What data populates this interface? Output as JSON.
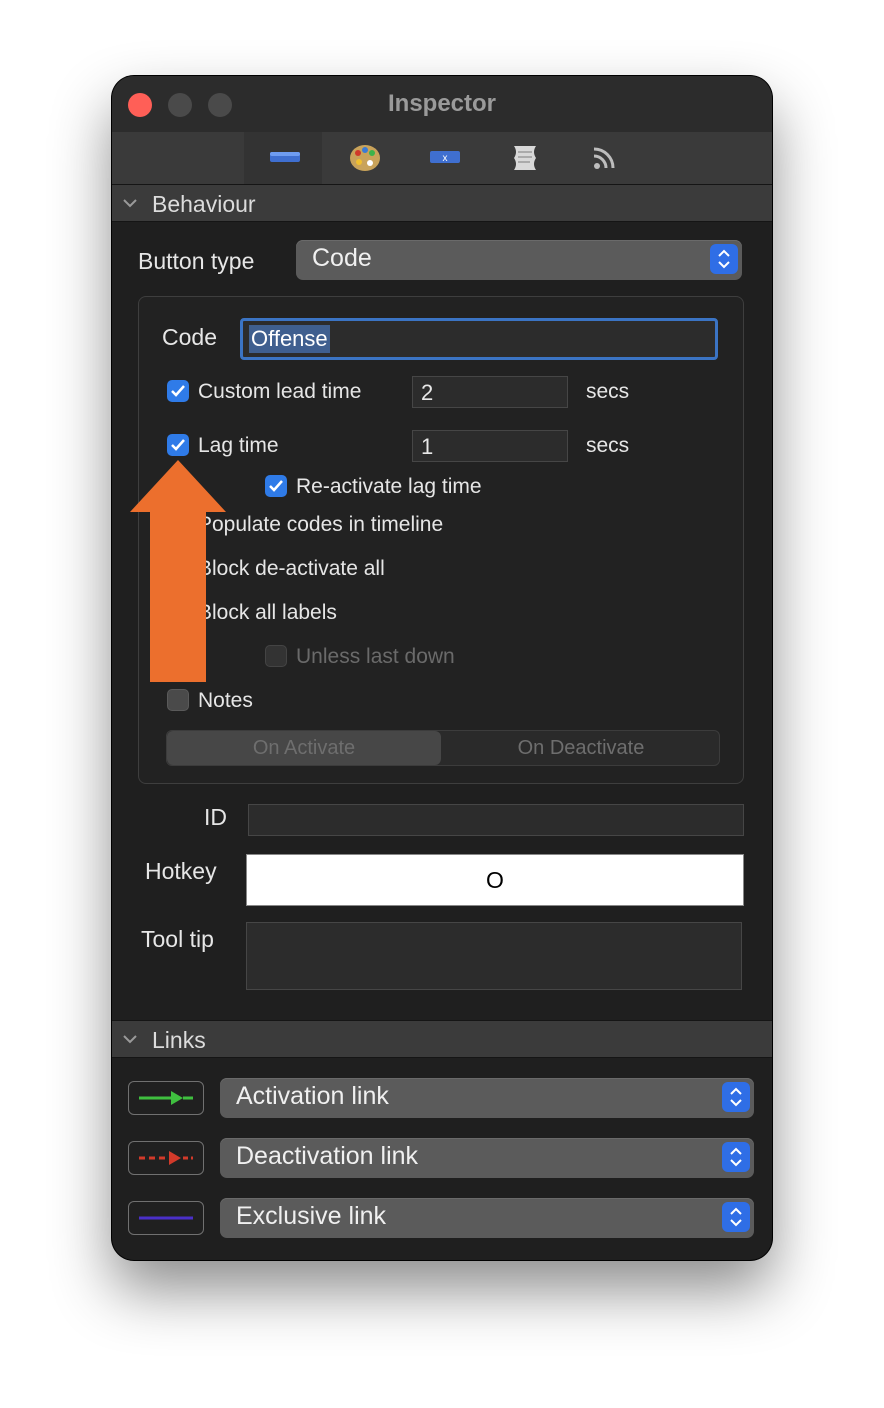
{
  "window": {
    "title": "Inspector"
  },
  "toolbar": {
    "icons": [
      "button-rect-icon",
      "palette-icon",
      "code-x-icon",
      "scroll-icon",
      "rss-icon"
    ]
  },
  "behaviour": {
    "header": "Behaviour",
    "button_type_label": "Button type",
    "button_type_value": "Code",
    "code_label": "Code",
    "code_value": "Offense",
    "custom_lead_time": {
      "label": "Custom lead time",
      "checked": true,
      "value": "2",
      "unit": "secs"
    },
    "lag_time": {
      "label": "Lag time",
      "checked": true,
      "value": "1",
      "unit": "secs"
    },
    "reactivate_lag_time": {
      "label": "Re-activate lag time",
      "checked": true
    },
    "populate_codes": {
      "label": "Populate codes in timeline"
    },
    "block_deactivate_all": {
      "label": "Block de-activate all"
    },
    "block_all_labels": {
      "label": "Block all labels"
    },
    "unless_last_down": {
      "label": "Unless last down",
      "checked": false,
      "disabled": true
    },
    "notes": {
      "label": "Notes",
      "checked": false
    },
    "segments": [
      "On Activate",
      "On Deactivate"
    ],
    "id_label": "ID",
    "id_value": "",
    "hotkey_label": "Hotkey",
    "hotkey_value": "O",
    "tooltip_label": "Tool tip",
    "tooltip_value": ""
  },
  "links": {
    "header": "Links",
    "items": [
      {
        "label": "Activation link",
        "color": "#3fbf3f"
      },
      {
        "label": "Deactivation link",
        "color": "#d23a2a"
      },
      {
        "label": "Exclusive link",
        "color": "#4a2fc8"
      }
    ]
  },
  "colors": {
    "accent": "#2f7be8",
    "annotation_arrow": "#ec6f2d"
  }
}
